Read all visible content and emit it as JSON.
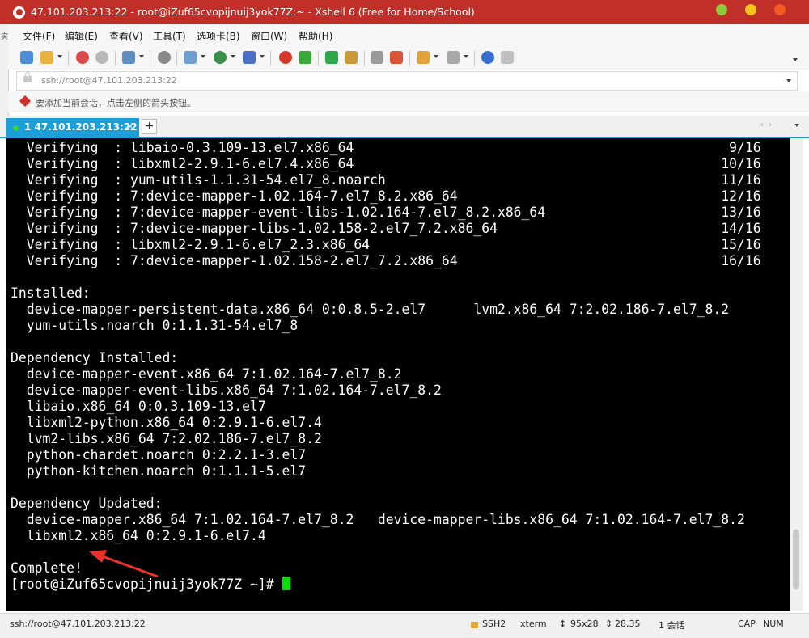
{
  "window": {
    "title": "47.101.203.213:22 - root@iZuf65cvopijnuij3yok77Z:~ - Xshell 6 (Free for Home/School)",
    "side_label": "实"
  },
  "menu": {
    "items": [
      "文件(F)",
      "编辑(E)",
      "查看(V)",
      "工具(T)",
      "选项卡(B)",
      "窗口(W)",
      "帮助(H)"
    ]
  },
  "toolbar": {
    "icons": [
      "new-session-icon",
      "open-folder-icon",
      "connect-icon",
      "disconnect-icon",
      "session-properties-icon",
      "find-icon",
      "transfer-icon",
      "globe-icon",
      "font-icon",
      "xshell-icon",
      "xftp-icon",
      "fullscreen-icon",
      "lock-icon",
      "keyboard-icon",
      "highlight-icon",
      "compose-icon",
      "layout-icon",
      "help-icon",
      "chat-icon"
    ]
  },
  "address": {
    "value": "ssh://root@47.101.203.213:22"
  },
  "hint": {
    "text": "要添加当前会话，点击左侧的箭头按钮。"
  },
  "tabs": {
    "active_label": "1 47.101.203.213:22",
    "close_glyph": "×",
    "add_glyph": "+"
  },
  "terminal": {
    "lines": [
      "  Verifying  : libaio-0.3.109-13.el7.x86_64                                               9/16",
      "  Verifying  : libxml2-2.9.1-6.el7.4.x86_64                                              10/16",
      "  Verifying  : yum-utils-1.1.31-54.el7_8.noarch                                          11/16",
      "  Verifying  : 7:device-mapper-1.02.164-7.el7_8.2.x86_64                                 12/16",
      "  Verifying  : 7:device-mapper-event-libs-1.02.164-7.el7_8.2.x86_64                      13/16",
      "  Verifying  : 7:device-mapper-libs-1.02.158-2.el7_7.2.x86_64                            14/16",
      "  Verifying  : libxml2-2.9.1-6.el7_2.3.x86_64                                            15/16",
      "  Verifying  : 7:device-mapper-1.02.158-2.el7_7.2.x86_64                                 16/16",
      "",
      "Installed:",
      "  device-mapper-persistent-data.x86_64 0:0.8.5-2.el7      lvm2.x86_64 7:2.02.186-7.el7_8.2",
      "  yum-utils.noarch 0:1.1.31-54.el7_8",
      "",
      "Dependency Installed:",
      "  device-mapper-event.x86_64 7:1.02.164-7.el7_8.2",
      "  device-mapper-event-libs.x86_64 7:1.02.164-7.el7_8.2",
      "  libaio.x86_64 0:0.3.109-13.el7",
      "  libxml2-python.x86_64 0:2.9.1-6.el7.4",
      "  lvm2-libs.x86_64 7:2.02.186-7.el7_8.2",
      "  python-chardet.noarch 0:2.2.1-3.el7",
      "  python-kitchen.noarch 0:1.1.1-5.el7",
      "",
      "Dependency Updated:",
      "  device-mapper.x86_64 7:1.02.164-7.el7_8.2   device-mapper-libs.x86_64 7:1.02.164-7.el7_8.2",
      "  libxml2.x86_64 0:2.9.1-6.el7.4",
      "",
      "Complete!"
    ],
    "prompt": "[root@iZuf65cvopijnuij3yok77Z ~]# "
  },
  "status": {
    "connection": "ssh://root@47.101.203.213:22",
    "protocol": "SSH2",
    "terminal_type": "xterm",
    "size": "95x28",
    "cursor_pos": "28,35",
    "sessions": "1 会话",
    "caps": "CAP",
    "num": "NUM"
  },
  "colors": {
    "title_bar": "#c03028",
    "tab_active": "#1a9fd8",
    "terminal_bg": "#000000",
    "terminal_fg": "#ffffff",
    "cursor": "#00e000",
    "annotation_arrow": "#e8322b"
  }
}
